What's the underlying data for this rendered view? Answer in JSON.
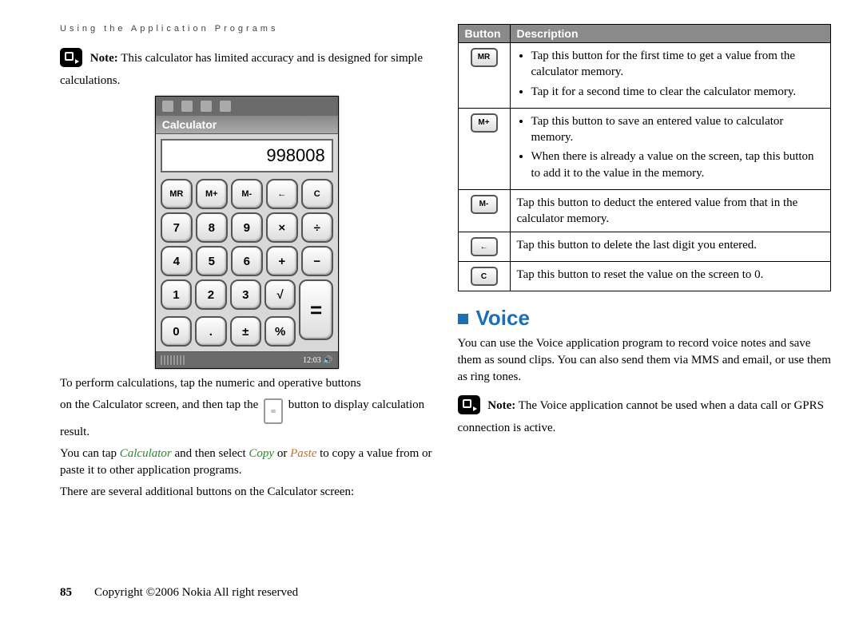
{
  "header": "Using the Application Programs",
  "note1_label": "Note:",
  "note1_text": "This calculator has limited accuracy and is designed for simple calculations.",
  "calculator": {
    "title": "Calculator",
    "display": "998008",
    "rows": [
      [
        "MR",
        "M+",
        "M-",
        "←",
        "C"
      ],
      [
        "7",
        "8",
        "9",
        "×",
        "÷"
      ],
      [
        "4",
        "5",
        "6",
        "+",
        "−"
      ]
    ],
    "row4_left": [
      "1",
      "2",
      "3",
      "√"
    ],
    "row5_left": [
      "0",
      ".",
      "±",
      "%"
    ],
    "equals": "=",
    "time": "12:03"
  },
  "para1a": "To perform calculations, tap the numeric and operative buttons",
  "para1b_pre": "on the Calculator screen, and then tap the",
  "para1b_eq": "=",
  "para1b_post": "button to display calculation result.",
  "para2_pre": "You can tap ",
  "para2_calc": "Calculator",
  "para2_mid1": " and then select ",
  "para2_copy": "Copy",
  "para2_mid2": " or ",
  "para2_paste": "Paste",
  "para2_post": " to copy a value from or paste it to other application programs.",
  "para3": "There are several additional buttons on the Calculator screen:",
  "table": {
    "h1": "Button",
    "h2": "Description",
    "rows": [
      {
        "btn": "MR",
        "bullets": [
          "Tap this button for the first time to get a value from the calculator memory.",
          "Tap it for a second time to clear the calculator memory."
        ]
      },
      {
        "btn": "M+",
        "bullets": [
          "Tap this button to save an entered value to calculator memory.",
          "When there is already a value on the screen, tap this button to add it to the value in the memory."
        ]
      },
      {
        "btn": "M-",
        "text": "Tap this button to deduct the entered value from that in the calculator memory."
      },
      {
        "btn": "←",
        "text": "Tap this button to delete the last digit you entered."
      },
      {
        "btn": "C",
        "text": "Tap this button to reset the value on the screen to 0."
      }
    ]
  },
  "voice_heading": "Voice",
  "voice_para": "You can use the Voice application program to record voice notes and save them as sound clips. You can also send them via MMS and email, or use them as ring tones.",
  "note2_label": "Note:",
  "note2_text": "The Voice application cannot be used when a data call or GPRS connection is active.",
  "footer_page": "85",
  "footer_text": "Copyright ©2006 Nokia All right reserved"
}
